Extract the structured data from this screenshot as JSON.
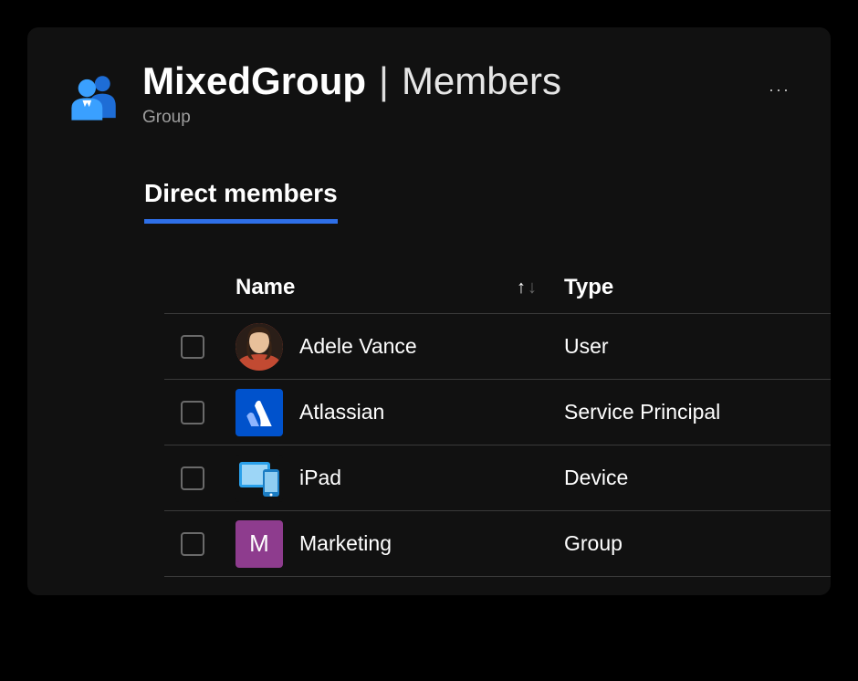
{
  "header": {
    "group_name": "MixedGroup",
    "separator": "|",
    "section": "Members",
    "subtitle": "Group"
  },
  "tab": {
    "label": "Direct members"
  },
  "table": {
    "columns": {
      "name": "Name",
      "type": "Type"
    },
    "rows": [
      {
        "name": "Adele Vance",
        "type": "User",
        "avatar": "person"
      },
      {
        "name": "Atlassian",
        "type": "Service Principal",
        "avatar": "atlassian"
      },
      {
        "name": "iPad",
        "type": "Device",
        "avatar": "device"
      },
      {
        "name": "Marketing",
        "type": "Group",
        "avatar": "initial",
        "initial": "M"
      }
    ]
  }
}
